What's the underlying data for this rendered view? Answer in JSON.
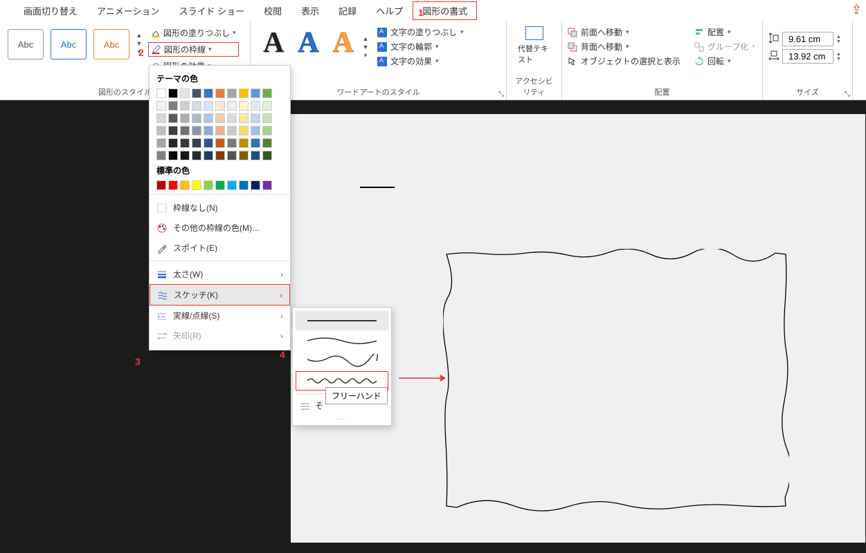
{
  "tabs": [
    "画面切り替え",
    "アニメーション",
    "スライド ショー",
    "校閲",
    "表示",
    "記録",
    "ヘルプ",
    "図形の書式"
  ],
  "annotations": {
    "a1": "1",
    "a2": "2",
    "a3": "3",
    "a4": "4"
  },
  "ribbon": {
    "shape_styles": {
      "label": "図形のスタイル",
      "samples": [
        "Abc",
        "Abc",
        "Abc"
      ],
      "fill": "図形の塗りつぶし",
      "outline": "図形の枠線",
      "effects": "図形の効果"
    },
    "wordart": {
      "label": "ワードアートのスタイル",
      "text_fill": "文字の塗りつぶし",
      "text_outline": "文字の輪郭",
      "text_effects": "文字の効果"
    },
    "accessibility": {
      "label": "アクセシビリティ",
      "alt_text": "代替テキスト"
    },
    "arrange": {
      "label": "配置",
      "bring_forward": "前面へ移動",
      "send_backward": "背面へ移動",
      "selection_pane": "オブジェクトの選択と表示",
      "align": "配置",
      "group": "グループ化",
      "rotate": "回転"
    },
    "size": {
      "label": "サイズ",
      "height": "9.61 cm",
      "width": "13.92 cm"
    }
  },
  "color_panel": {
    "theme_title": "テーマの色",
    "theme_top": [
      "#ffffff",
      "#000000",
      "#e7e6e6",
      "#44546a",
      "#4472c4",
      "#ed7d31",
      "#a5a5a5",
      "#ffc000",
      "#5b9bd5",
      "#70ad47"
    ],
    "theme_shades": [
      [
        "#f2f2f2",
        "#7f7f7f",
        "#d0cece",
        "#d6dce4",
        "#d9e2f3",
        "#fbe5d5",
        "#ededed",
        "#fff2cc",
        "#deebf6",
        "#e2efd9"
      ],
      [
        "#d8d8d8",
        "#595959",
        "#aeabab",
        "#adb9ca",
        "#b4c6e7",
        "#f7cbac",
        "#dbdbdb",
        "#fee599",
        "#bdd7ee",
        "#c5e0b3"
      ],
      [
        "#bfbfbf",
        "#3f3f3f",
        "#757070",
        "#8496b0",
        "#8eaadb",
        "#f4b183",
        "#c9c9c9",
        "#ffd965",
        "#9cc3e5",
        "#a8d08d"
      ],
      [
        "#a5a5a5",
        "#262626",
        "#3a3838",
        "#323f4f",
        "#2f5496",
        "#c55a11",
        "#7b7b7b",
        "#bf9000",
        "#2e75b5",
        "#538135"
      ],
      [
        "#7f7f7f",
        "#0c0c0c",
        "#171616",
        "#222a35",
        "#1f3864",
        "#833c0b",
        "#525252",
        "#7f6000",
        "#1e4e79",
        "#375623"
      ]
    ],
    "standard_title": "標準の色",
    "standard": [
      "#c00000",
      "#ff0000",
      "#ffc000",
      "#ffff00",
      "#92d050",
      "#00b050",
      "#00b0f0",
      "#0070c0",
      "#002060",
      "#7030a0"
    ],
    "no_outline": "枠線なし(N)",
    "more_colors": "その他の枠線の色(M)…",
    "eyedropper": "スポイト(E)",
    "weight": "太さ(W)",
    "sketched": "スケッチ(K)",
    "dashes": "実線/点線(S)",
    "arrows": "矢印(R)"
  },
  "sketch_flyout": {
    "more": "そ",
    "tooltip": "フリーハンド"
  }
}
